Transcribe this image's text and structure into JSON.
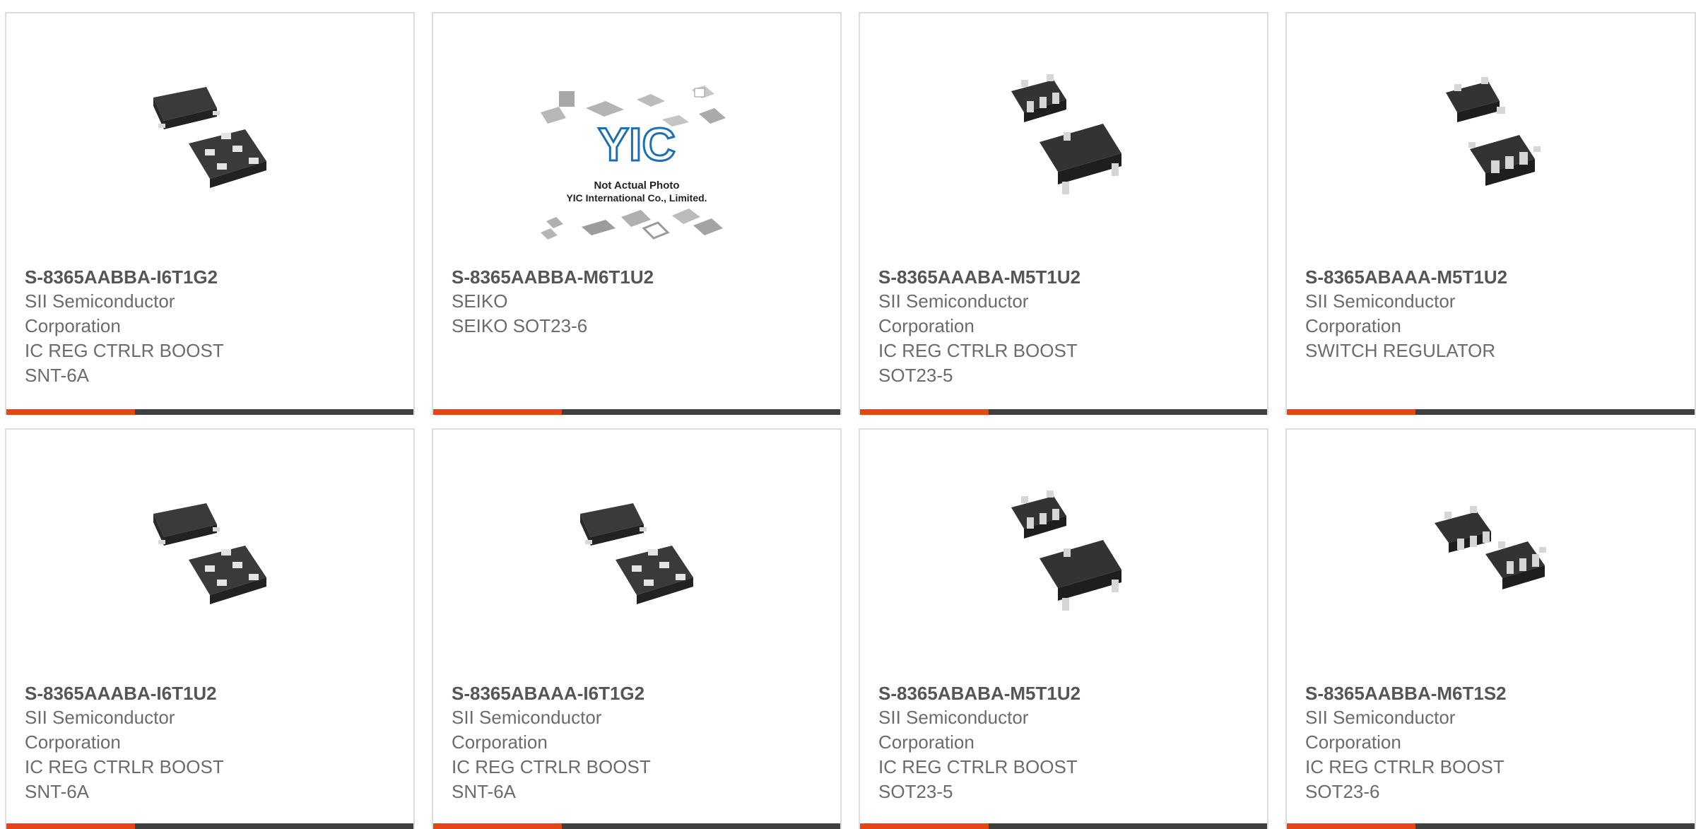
{
  "colors": {
    "accent": "#e64514",
    "bar": "#3f3f3f",
    "border": "#dcdcdc",
    "title": "#555555",
    "text": "#6b6b6b"
  },
  "products": [
    {
      "part_number": "S-8365AABBA-I6T1G2",
      "manufacturer": "SII Semiconductor Corporation",
      "description": "IC REG CTRLR BOOST SNT-6A",
      "image": "snt-6a-package-icon"
    },
    {
      "part_number": "S-8365AABBA-M6T1U2",
      "manufacturer": "SEIKO",
      "description": "SEIKO SOT23-6",
      "image": "not-actual-photo-placeholder",
      "placeholder_text": [
        "YIC",
        "Not Actual Photo",
        "YIC International Co., Limited."
      ]
    },
    {
      "part_number": "S-8365AAABA-M5T1U2",
      "manufacturer": "SII Semiconductor Corporation",
      "description": "IC REG CTRLR BOOST SOT23-5",
      "image": "sot23-5-package-icon"
    },
    {
      "part_number": "S-8365ABAAA-M5T1U2",
      "manufacturer": "SII Semiconductor Corporation",
      "description": "SWITCH REGULATOR",
      "image": "sot23-5-package-icon"
    },
    {
      "part_number": "S-8365AAABA-I6T1U2",
      "manufacturer": "SII Semiconductor Corporation",
      "description": "IC REG CTRLR BOOST SNT-6A",
      "image": "snt-6a-package-icon"
    },
    {
      "part_number": "S-8365ABAAA-I6T1G2",
      "manufacturer": "SII Semiconductor Corporation",
      "description": "IC REG CTRLR BOOST SNT-6A",
      "image": "snt-6a-package-icon"
    },
    {
      "part_number": "S-8365ABABA-M5T1U2",
      "manufacturer": "SII Semiconductor Corporation",
      "description": "IC REG CTRLR BOOST SOT23-5",
      "image": "sot23-5-package-icon"
    },
    {
      "part_number": "S-8365AABBA-M6T1S2",
      "manufacturer": "SII Semiconductor Corporation",
      "description": "IC REG CTRLR BOOST SOT23-6",
      "image": "sot23-6-package-icon"
    }
  ]
}
